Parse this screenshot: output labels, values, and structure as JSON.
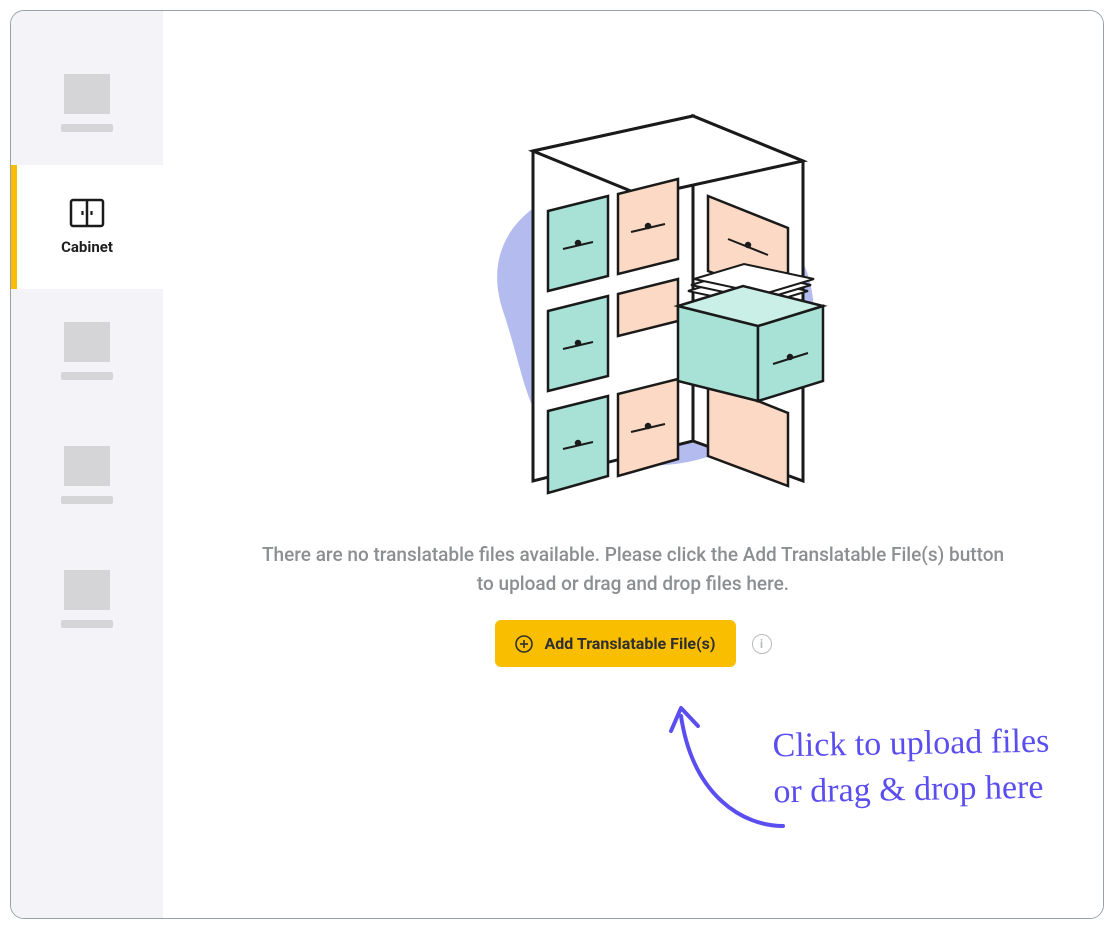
{
  "sidebar": {
    "active_item_label": "Cabinet"
  },
  "empty_state": {
    "message": "There are no translatable files available. Please click the Add Translatable File(s) button to upload or drag and drop files here.",
    "button_label": "Add Translatable File(s)"
  },
  "annotation": {
    "line1": "Click to upload files",
    "line2": "or drag & drop here"
  }
}
